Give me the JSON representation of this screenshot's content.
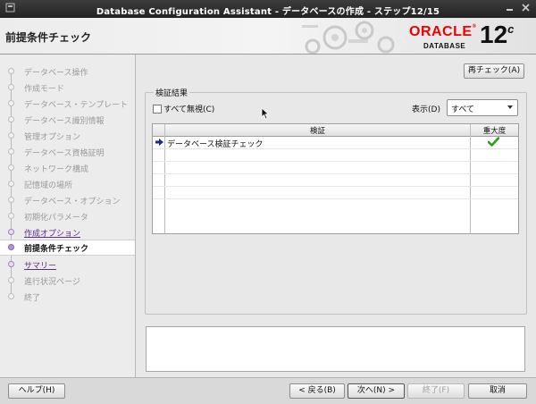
{
  "window": {
    "title": "Database Configuration Assistant - データベースの作成 - ステップ12/15"
  },
  "header": {
    "step_title": "前提条件チェック",
    "logo_oracle": "ORACLE",
    "logo_registered": "®",
    "logo_database": "DATABASE",
    "logo_version": "12",
    "logo_version_suffix": "c"
  },
  "sidebar": {
    "items": [
      {
        "label": "データベース操作",
        "state": "disabled"
      },
      {
        "label": "作成モード",
        "state": "disabled"
      },
      {
        "label": "データベース・テンプレート",
        "state": "disabled"
      },
      {
        "label": "データベース識別情報",
        "state": "disabled"
      },
      {
        "label": "管理オプション",
        "state": "disabled"
      },
      {
        "label": "データベース資格証明",
        "state": "disabled"
      },
      {
        "label": "ネットワーク構成",
        "state": "disabled"
      },
      {
        "label": "記憶域の場所",
        "state": "disabled"
      },
      {
        "label": "データベース・オプション",
        "state": "disabled"
      },
      {
        "label": "初期化パラメータ",
        "state": "disabled"
      },
      {
        "label": "作成オプション",
        "state": "link"
      },
      {
        "label": "前提条件チェック",
        "state": "active"
      },
      {
        "label": "サマリー",
        "state": "link"
      },
      {
        "label": "進行状況ページ",
        "state": "disabled"
      },
      {
        "label": "終了",
        "state": "disabled"
      }
    ]
  },
  "main": {
    "recheck_button": "再チェック(A)",
    "group_title": "検証結果",
    "ignore_all_label": "すべて無視(C)",
    "ignore_all_checked": false,
    "show_label": "表示(D)",
    "show_value": "すべて",
    "table": {
      "columns": [
        "検証",
        "重大度"
      ],
      "rows": [
        {
          "check": "データベース検証チェック",
          "severity_icon": "check-icon"
        }
      ]
    }
  },
  "footer": {
    "help_button": "ヘルプ(H)",
    "back_button": "< 戻る(B)",
    "next_button": "次へ(N) >",
    "finish_button": "終了(F)",
    "cancel_button": "取消"
  },
  "colors": {
    "accent_purple": "#5b2e86",
    "oracle_red": "#e00000",
    "check_green": "#2e9d1e",
    "arrow_navy": "#1c2a8c"
  }
}
